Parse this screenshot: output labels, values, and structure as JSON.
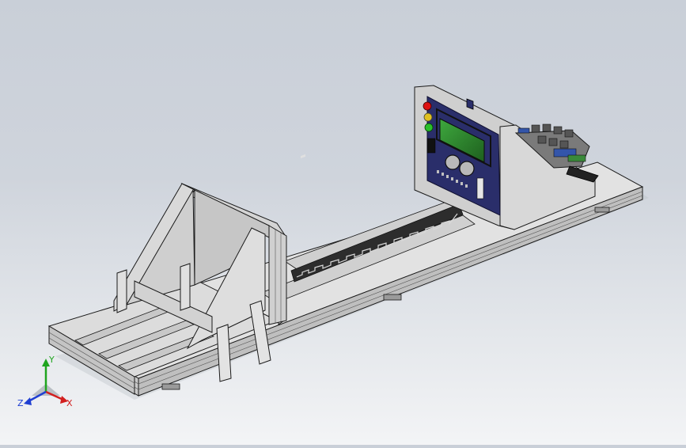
{
  "viewport": {
    "background_top": "#c9cfd8",
    "background_bottom": "#f3f4f6",
    "model_face_color": "#d7d7d7",
    "model_edge_color": "#1a1a1a"
  },
  "triad": {
    "x_label": "X",
    "y_label": "Y",
    "z_label": "Z",
    "x_color": "#d21f1f",
    "y_color": "#1fa51f",
    "z_color": "#1f3fd2"
  },
  "indicators": {
    "led_colors": [
      "#d11",
      "#e0c020",
      "#2bbf2b"
    ]
  }
}
